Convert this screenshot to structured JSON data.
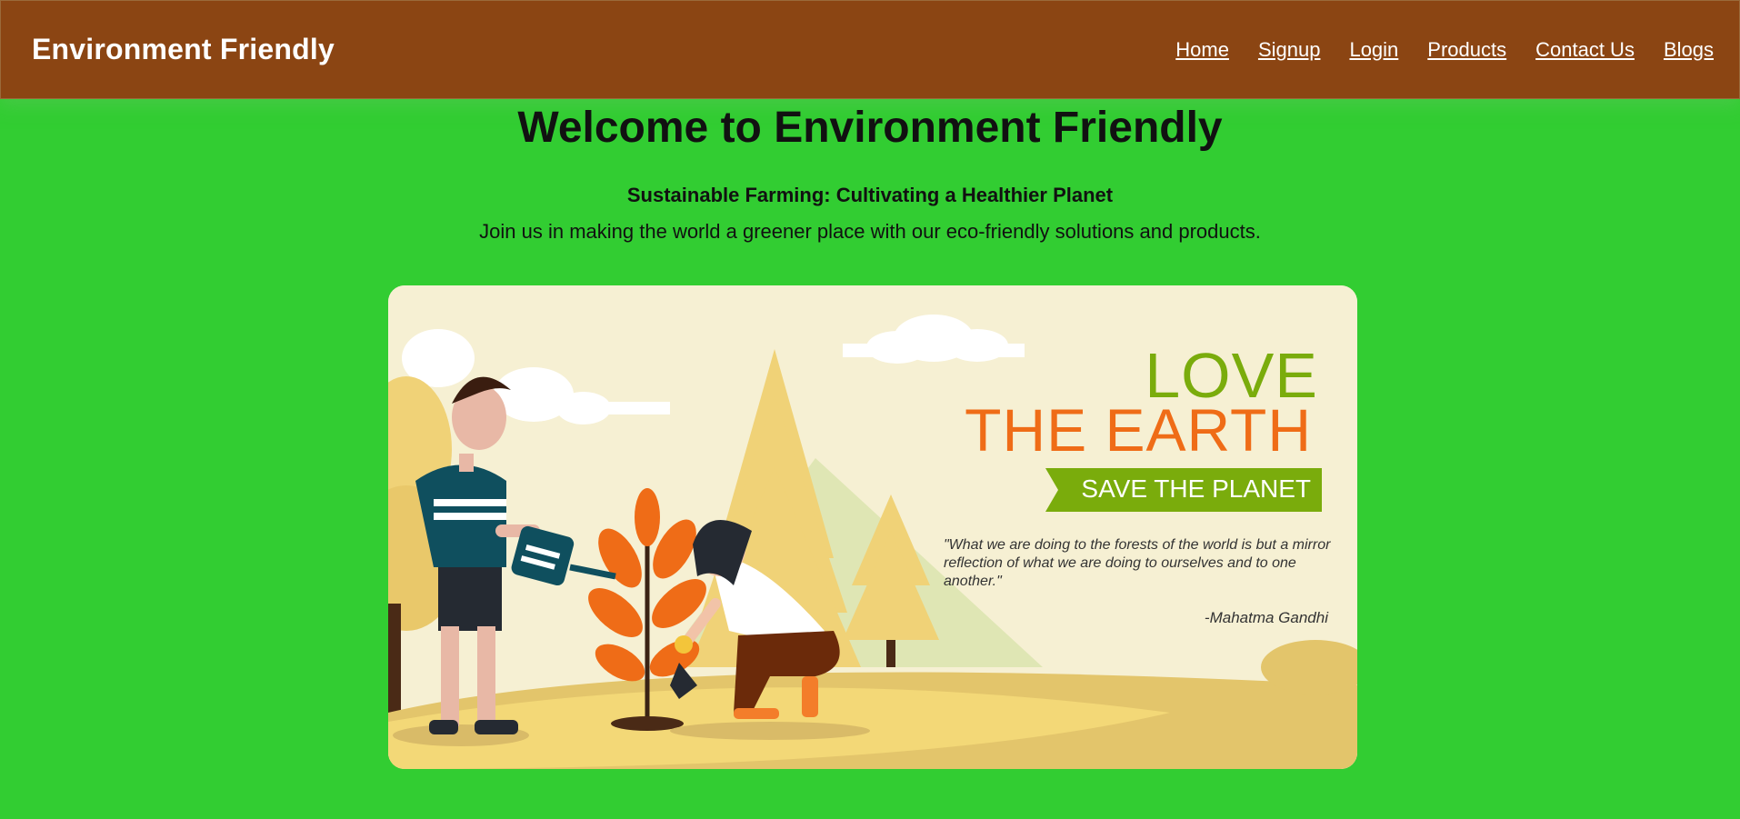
{
  "header": {
    "brand": "Environment Friendly",
    "nav": [
      "Home",
      "Signup",
      "Login",
      "Products",
      "Contact Us",
      "Blogs"
    ]
  },
  "hero": {
    "title": "Welcome to Environment Friendly",
    "subtitle": "Sustainable Farming: Cultivating a Healthier Planet",
    "tagline": "Join us in making the world a greener place with our eco-friendly solutions and products."
  },
  "banner": {
    "line1": "LOVE",
    "line2": "THE EARTH",
    "ribbon": "SAVE THE PLANET",
    "quote": "\"What we are doing to the forests of the world is but a mirror reflection of what we are doing to ourselves and to one another.\"",
    "author": "-Mahatma Gandhi"
  },
  "colors": {
    "page_bg": "#32cd32",
    "header_bg": "#8b4513",
    "love_green": "#7aac0c",
    "earth_orange": "#ef6c17"
  }
}
